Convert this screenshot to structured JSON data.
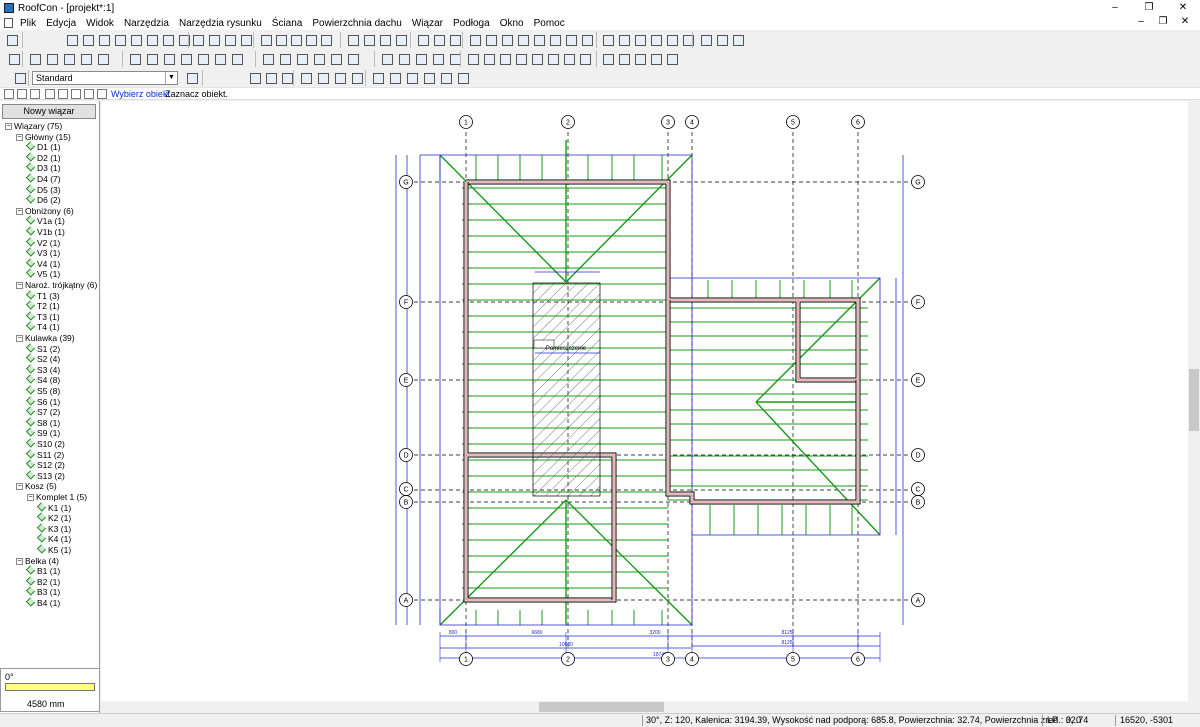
{
  "window": {
    "title": "RoofCon - [projekt*:1]"
  },
  "menu": [
    "Plik",
    "Edycja",
    "Widok",
    "Narzędzia",
    "Narzędzia rysunku",
    "Ściana",
    "Powierzchnia dachu",
    "Wiązar",
    "Podłoga",
    "Okno",
    "Pomoc"
  ],
  "toolbar": {
    "style_combo": "Standard"
  },
  "command": {
    "prompt": "Wybierz obiekt",
    "hint": "Zaznacz obiekt."
  },
  "sidebar": {
    "new_button": "Nowy wiązar",
    "tree": [
      {
        "label": "Wiązary (75)",
        "level": 0,
        "group": true
      },
      {
        "label": "Główny (15)",
        "level": 1,
        "group": true
      },
      {
        "label": "D1 (1)",
        "level": 2
      },
      {
        "label": "D2 (1)",
        "level": 2
      },
      {
        "label": "D3 (1)",
        "level": 2
      },
      {
        "label": "D4 (7)",
        "level": 2
      },
      {
        "label": "D5 (3)",
        "level": 2
      },
      {
        "label": "D6 (2)",
        "level": 2
      },
      {
        "label": "Obniżony (6)",
        "level": 1,
        "group": true
      },
      {
        "label": "V1a (1)",
        "level": 2
      },
      {
        "label": "V1b (1)",
        "level": 2
      },
      {
        "label": "V2 (1)",
        "level": 2
      },
      {
        "label": "V3 (1)",
        "level": 2
      },
      {
        "label": "V4 (1)",
        "level": 2
      },
      {
        "label": "V5 (1)",
        "level": 2
      },
      {
        "label": "Naroż. trójkątny (6)",
        "level": 1,
        "group": true
      },
      {
        "label": "T1 (3)",
        "level": 2
      },
      {
        "label": "T2 (1)",
        "level": 2
      },
      {
        "label": "T3 (1)",
        "level": 2
      },
      {
        "label": "T4 (1)",
        "level": 2
      },
      {
        "label": "Kulawka (39)",
        "level": 1,
        "group": true
      },
      {
        "label": "S1 (2)",
        "level": 2
      },
      {
        "label": "S2 (4)",
        "level": 2
      },
      {
        "label": "S3 (4)",
        "level": 2
      },
      {
        "label": "S4 (8)",
        "level": 2
      },
      {
        "label": "S5 (8)",
        "level": 2
      },
      {
        "label": "S6 (1)",
        "level": 2
      },
      {
        "label": "S7 (2)",
        "level": 2
      },
      {
        "label": "S8 (1)",
        "level": 2
      },
      {
        "label": "S9 (1)",
        "level": 2
      },
      {
        "label": "S10 (2)",
        "level": 2
      },
      {
        "label": "S11 (2)",
        "level": 2
      },
      {
        "label": "S12 (2)",
        "level": 2
      },
      {
        "label": "S13 (2)",
        "level": 2
      },
      {
        "label": "Kosz (5)",
        "level": 1,
        "group": true
      },
      {
        "label": "Komplet 1 (5)",
        "level": 2,
        "group": true
      },
      {
        "label": "K1 (1)",
        "level": 3
      },
      {
        "label": "K2 (1)",
        "level": 3
      },
      {
        "label": "K3 (1)",
        "level": 3
      },
      {
        "label": "K4 (1)",
        "level": 3
      },
      {
        "label": "K5 (1)",
        "level": 3
      },
      {
        "label": "Belka (4)",
        "level": 1,
        "group": true
      },
      {
        "label": "B1 (1)",
        "level": 2
      },
      {
        "label": "B2 (1)",
        "level": 2
      },
      {
        "label": "B3 (1)",
        "level": 2
      },
      {
        "label": "B4 (1)",
        "level": 2
      }
    ],
    "angle": "0°",
    "length": "4580 mm"
  },
  "drawing": {
    "axes_top": [
      "1",
      "2",
      "3",
      "4",
      "5",
      "6"
    ],
    "axes_side": [
      "G",
      "F",
      "E",
      "D",
      "C",
      "B",
      "A"
    ],
    "dims_bottom": [
      "800",
      "6680",
      "3200",
      "8125",
      "10680",
      "8125",
      "18745"
    ],
    "room_label": "Pomieszczenie",
    "colors": {
      "truss": "#1a9a1a",
      "wall": "#000000",
      "plate": "#d04040",
      "dim": "#1f2fd0",
      "grid": "#000000"
    }
  },
  "status": {
    "info": "30°, Z: 120, Kalenica: 3194.39, Wysokość nad podporą: 685.8, Powierzchnia: 32.74, Powierzchnia zred.: 32.74",
    "mode": "LP",
    "snap": "0, 0",
    "coords": "16520, -5301"
  }
}
